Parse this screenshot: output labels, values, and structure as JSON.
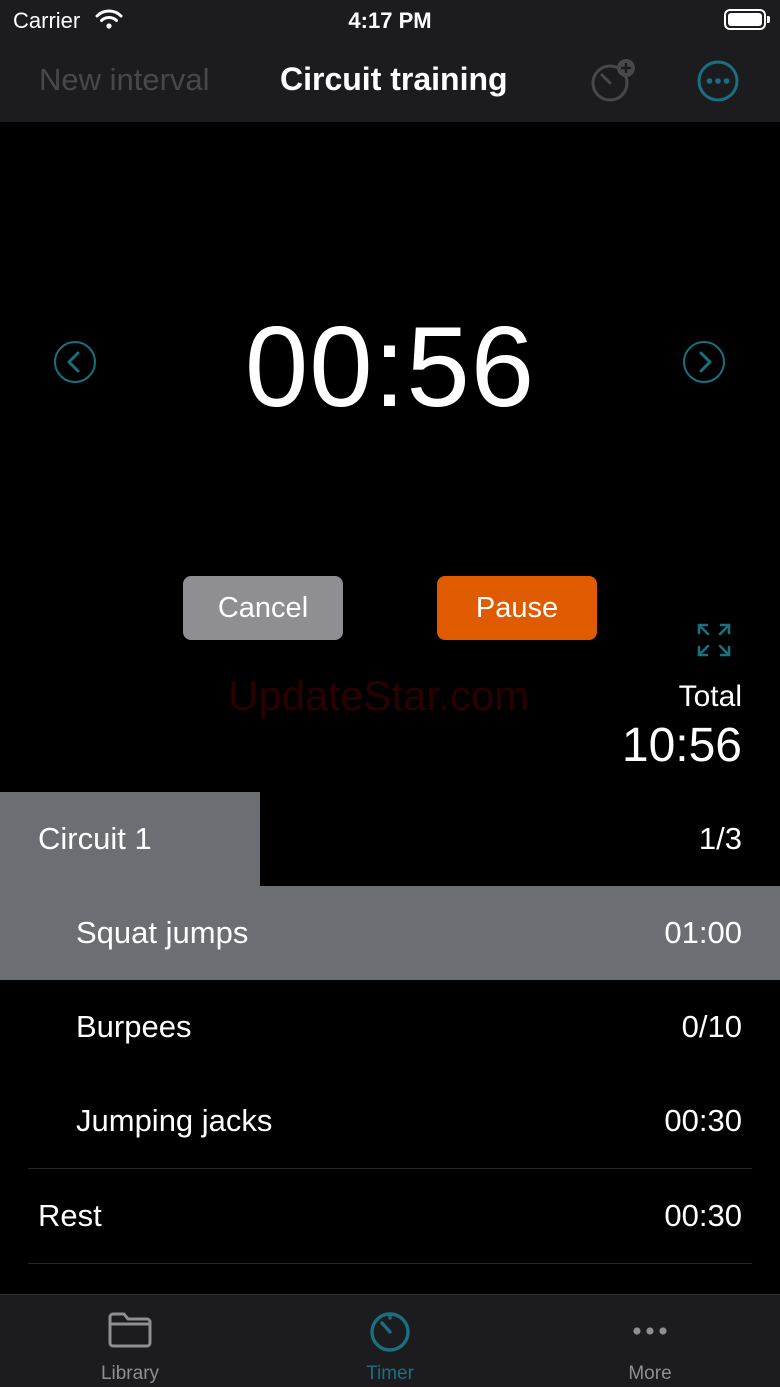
{
  "status_bar": {
    "carrier": "Carrier",
    "time": "4:17 PM",
    "icons": [
      "wifi-icon",
      "battery-icon"
    ]
  },
  "nav": {
    "left_label": "New interval",
    "title": "Circuit training",
    "icons": [
      "add-timer-icon",
      "more-options-icon"
    ]
  },
  "timer": {
    "time": "00:56",
    "prev_icon": "chevron-left-icon",
    "next_icon": "chevron-right-icon"
  },
  "controls": {
    "cancel_label": "Cancel",
    "pause_label": "Pause",
    "expand_icon": "fullscreen-expand-icon"
  },
  "total": {
    "label": "Total",
    "value": "10:56"
  },
  "watermark": "UpdateStar.com",
  "list": {
    "group": {
      "label": "Circuit 1",
      "value": "1/3"
    },
    "items": [
      {
        "label": "Squat jumps",
        "value": "01:00"
      },
      {
        "label": "Burpees",
        "value": "0/10"
      },
      {
        "label": "Jumping jacks",
        "value": "00:30"
      }
    ],
    "rest": {
      "label": "Rest",
      "value": "00:30"
    }
  },
  "tab_bar": {
    "tabs": [
      {
        "label": "Library",
        "icon": "folder-icon"
      },
      {
        "label": "Timer",
        "icon": "timer-icon"
      },
      {
        "label": "More",
        "icon": "ellipsis-icon"
      }
    ],
    "active_index": 1
  },
  "colors": {
    "accent": "#1a6f80",
    "pause": "#e05a00",
    "cancel": "#8e8e93",
    "highlight": "#6b6e72",
    "bar": "#1c1c1e"
  }
}
